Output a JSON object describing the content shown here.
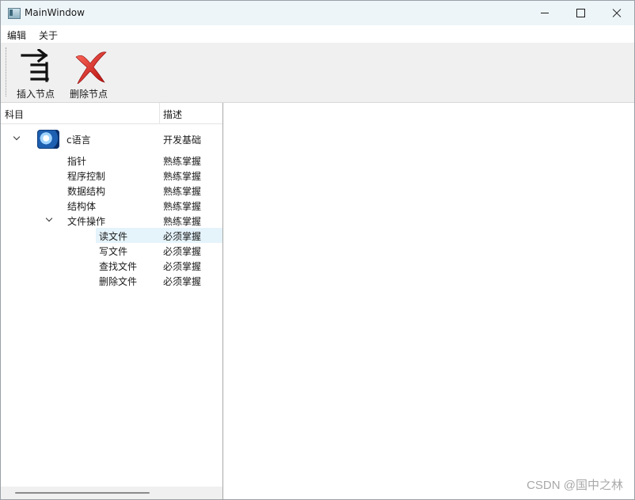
{
  "window": {
    "title": "MainWindow"
  },
  "menu": {
    "edit": "编辑",
    "about": "关于"
  },
  "toolbar": {
    "insert_label": "插入节点",
    "delete_label": "删除节点"
  },
  "tree": {
    "headers": {
      "subject": "科目",
      "description": "描述"
    },
    "rows": [
      {
        "name": "c语言",
        "desc": "开发基础",
        "expanded": true
      },
      {
        "name": "指针",
        "desc": "熟练掌握"
      },
      {
        "name": "程序控制",
        "desc": "熟练掌握"
      },
      {
        "name": "数据结构",
        "desc": "熟练掌握"
      },
      {
        "name": "结构体",
        "desc": "熟练掌握"
      },
      {
        "name": "文件操作",
        "desc": "熟练掌握",
        "expanded": true
      },
      {
        "name": "读文件",
        "desc": "必须掌握",
        "selected": true
      },
      {
        "name": "写文件",
        "desc": "必须掌握"
      },
      {
        "name": "查找文件",
        "desc": "必须掌握"
      },
      {
        "name": "删除文件",
        "desc": "必须掌握"
      }
    ]
  },
  "watermark": "CSDN @国中之林",
  "colors": {
    "selection": "#e5f3fb",
    "titlebar": "#eef5f8",
    "toolbar": "#f0f0f0"
  }
}
